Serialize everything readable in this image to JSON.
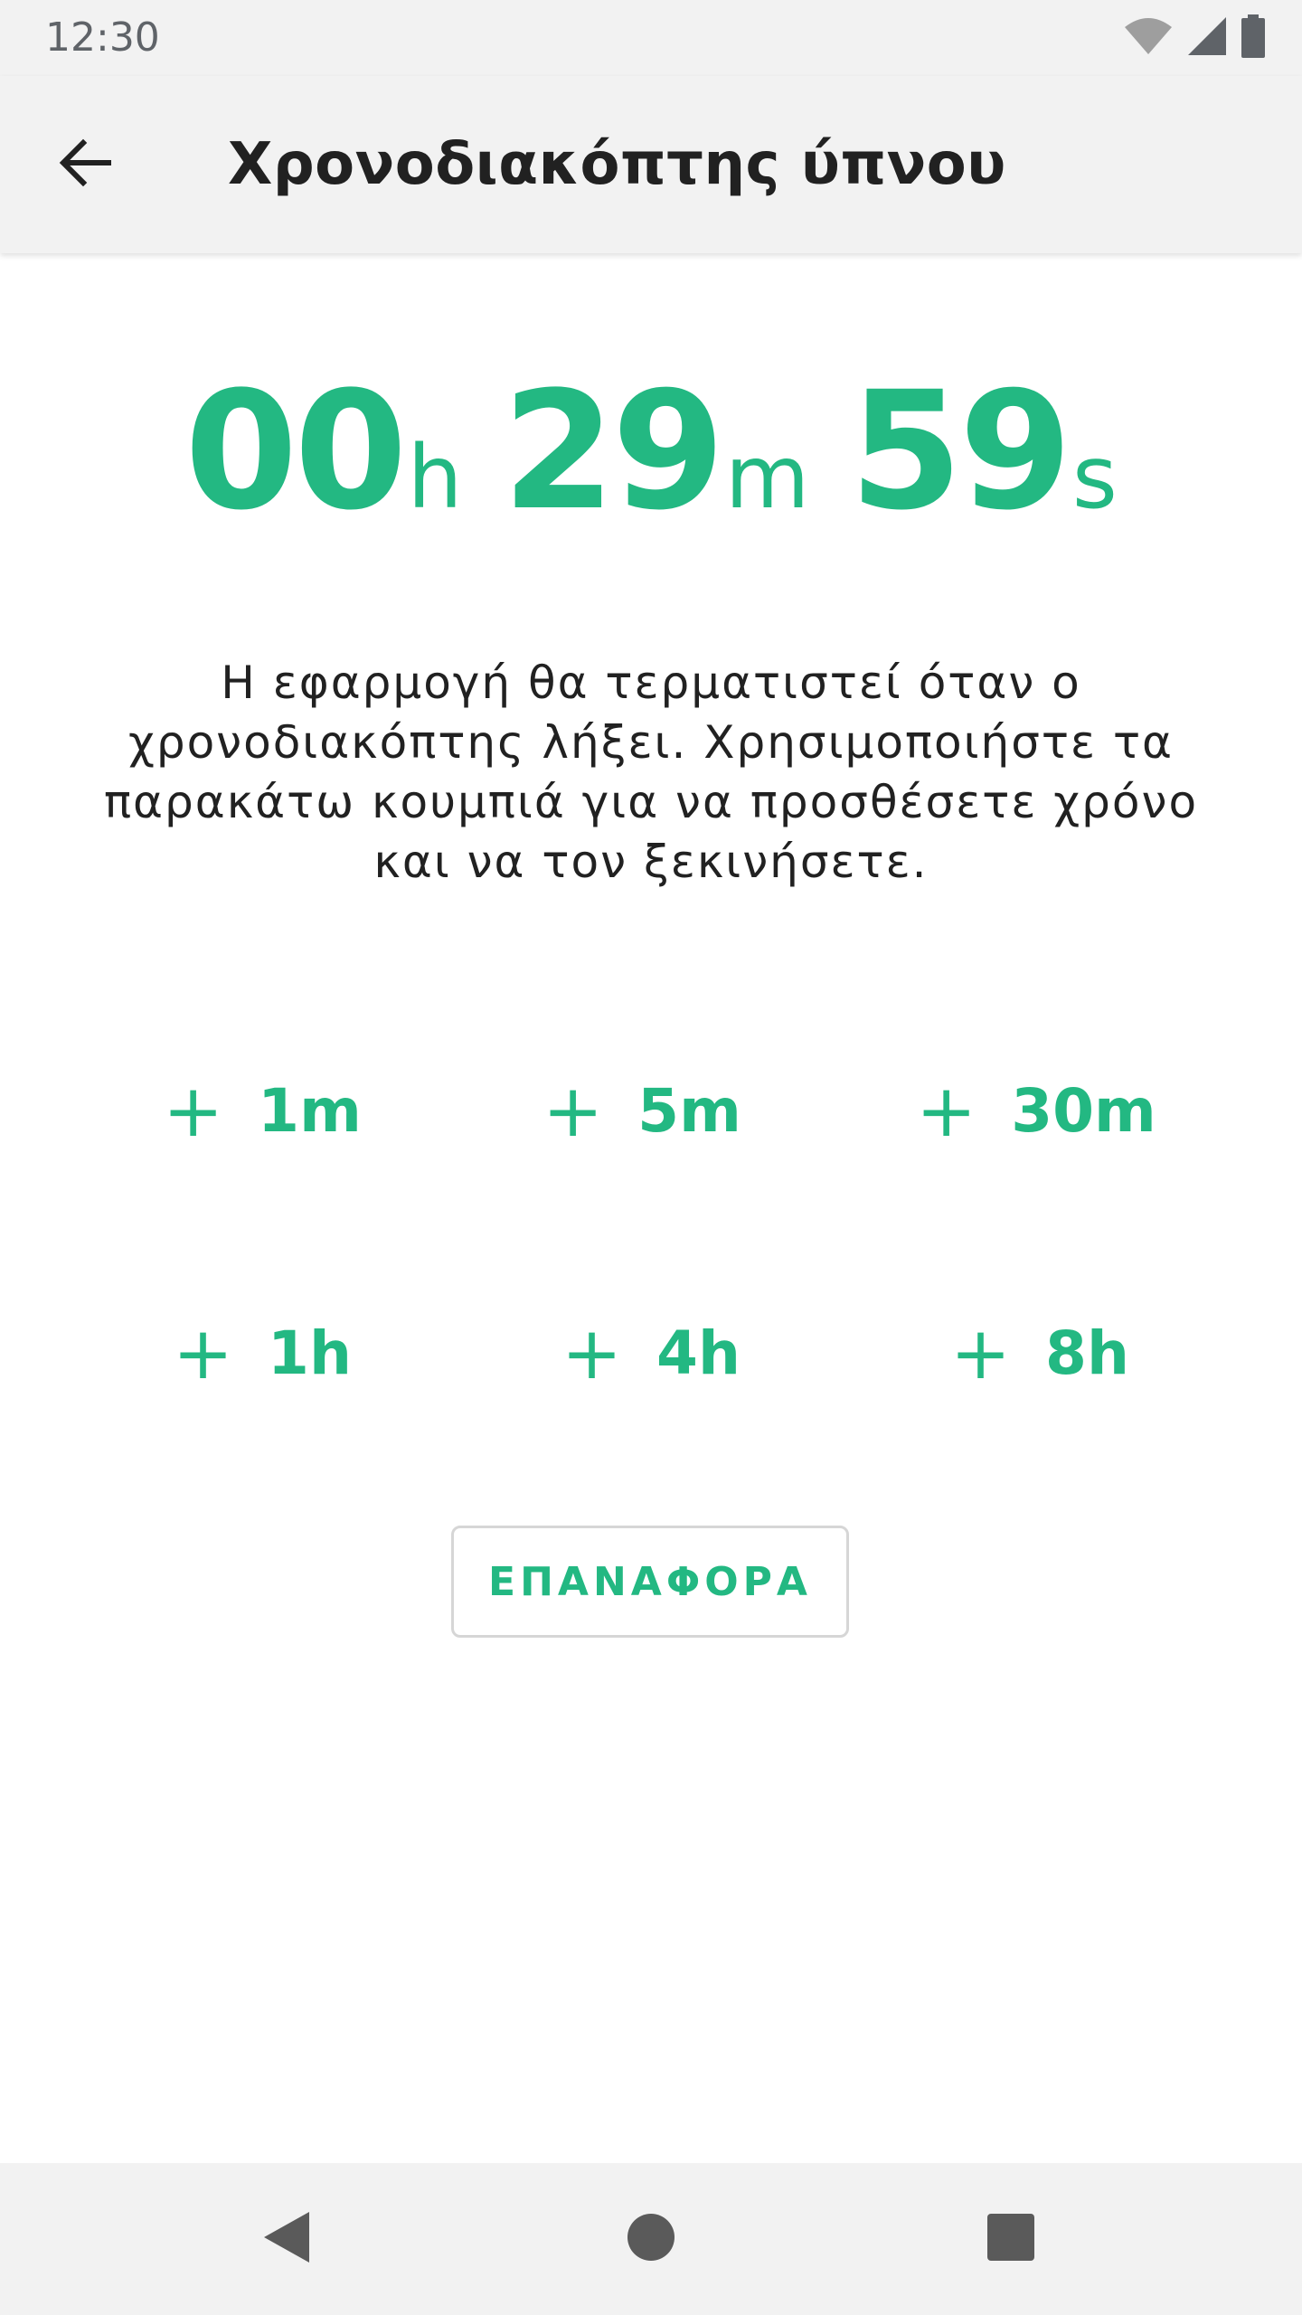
{
  "status_bar": {
    "time": "12:30",
    "icons": [
      "wifi-icon",
      "cellular-signal-icon",
      "battery-icon"
    ]
  },
  "app_bar": {
    "back_icon": "arrow-back-icon",
    "title": "Χρονοδιακόπτης ύπνου"
  },
  "timer": {
    "hours": "00",
    "hours_unit": "h",
    "minutes": "29",
    "minutes_unit": "m",
    "seconds": "59",
    "seconds_unit": "s"
  },
  "description": "Η εφαρμογή θα τερματιστεί όταν ο χρονοδιακόπτης λήξει. Χρησιμοποιήστε τα παρακάτω κουμπιά για να προσθέσετε χρόνο και να τον ξεκινήσετε.",
  "add_buttons": [
    {
      "plus": "+",
      "label": "1m"
    },
    {
      "plus": "+",
      "label": "5m"
    },
    {
      "plus": "+",
      "label": "30m"
    },
    {
      "plus": "+",
      "label": "1h"
    },
    {
      "plus": "+",
      "label": "4h"
    },
    {
      "plus": "+",
      "label": "8h"
    }
  ],
  "reset_button": {
    "label": "ΕΠΑΝΑΦΟΡΑ"
  },
  "nav_bar": {
    "icons": [
      "nav-back-icon",
      "nav-home-icon",
      "nav-recents-icon"
    ]
  },
  "colors": {
    "accent": "#23b882",
    "bar_background": "#f2f2f2",
    "text_primary": "#212121",
    "status_icon": "#757575",
    "nav_icon": "#5a5a5a"
  }
}
